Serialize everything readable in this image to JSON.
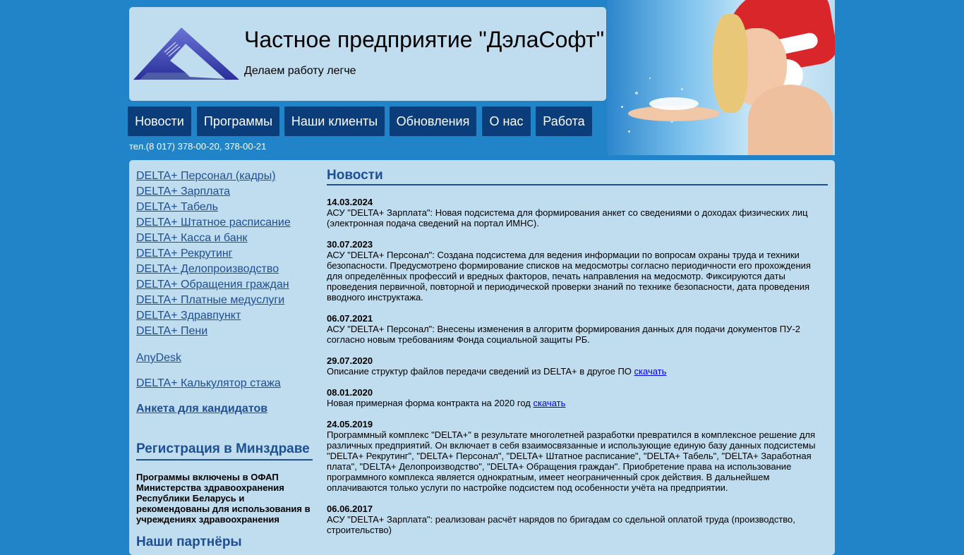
{
  "header": {
    "title": "Частное предприятие \"ДэлаСофт\"",
    "slogan": "Делаем работу легче"
  },
  "nav": [
    {
      "label": "Новости"
    },
    {
      "label": "Программы"
    },
    {
      "label": "Наши клиенты"
    },
    {
      "label": "Обновления"
    },
    {
      "label": "О нас"
    },
    {
      "label": "Работа"
    }
  ],
  "phone": "тел.(8 017) 378-00-20, 378-00-21",
  "sidebar": {
    "programs": [
      "DELTA+ Персонал (кадры)",
      "DELTA+ Зарплата",
      "DELTA+ Табель",
      "DELTA+ Штатное расписание",
      "DELTA+ Касса и банк",
      "DELTA+ Рекрутинг",
      "DELTA+ Делопроизводство",
      "DELTA+ Обращения граждан",
      "DELTA+ Платные медуслуги",
      "DELTA+ Здравпункт",
      "DELTA+ Пени"
    ],
    "anydesk": "AnyDesk",
    "calculator": "DELTA+ Калькулятор стажа",
    "anketa": "Анкета для кандидатов",
    "minzdrav_heading": "Регистрация в Минздраве",
    "minzdrav_text": "Программы включены в ОФАП Министерства здравоохранения Республики Беларусь и рекомендованы для использования в учреждениях здравоохранения",
    "partners_heading": "Наши партнёры"
  },
  "news": {
    "heading": "Новости",
    "items": [
      {
        "date": "14.03.2024",
        "text": "АСУ \"DELTA+ Зарплата\": Новая подсистема для формирования анкет со сведениями о доходах физических лиц (электронная подача сведений на портал ИМНС)."
      },
      {
        "date": "30.07.2023",
        "text": "АСУ \"DELTA+ Персонал\": Создана подсистема для ведения информации по вопросам охраны труда и техники безопасности. Предусмотрено формирование списков на медосмотры согласно периодичности его прохождения для определённых профессий и вредных факторов, печать направления на медосмотр. Фиксируются даты проведения первичной, повторной и периодической проверки знаний по технике безопасности, дата проведения вводного инструктажа."
      },
      {
        "date": "06.07.2021",
        "text": "АСУ \"DELTA+ Персонал\": Внесены изменения в алгоритм формирования данных для подачи документов ПУ-2 согласно новым требованиям Фонда социальной защиты РБ."
      },
      {
        "date": "29.07.2020",
        "text": "Описание структур файлов передачи сведений из DELTA+ в другое ПО",
        "link": "скачать"
      },
      {
        "date": "08.01.2020",
        "text": "Новая примерная форма контракта на 2020 год",
        "link": "скачать"
      },
      {
        "date": "24.05.2019",
        "text": "Программный комплекс \"DELTA+\" в результате многолетней разработки превратился в комплексное решение для различных предприятий. Он включает в себя взаимосвязанные и использующие единую базу данных подсистемы \"DELTA+ Рекрутинг\", \"DELTA+ Персонал\", \"DELTA+ Штатное расписание\", \"DELTA+ Табель\", \"DELTA+ Заработная плата\", \"DELTA+ Делопроизводство\", \"DELTA+ Обращения граждан\". Приобретение права на использование программного комплекса является однократным, имеет неограниченный срок действия. В дальнейшем оплачиваются только услуги по настройке подсистем под особенности учёта на предприятии."
      },
      {
        "date": "06.06.2017",
        "text": "АСУ \"DELTA+ Зарплата\": реализован расчёт нарядов по бригадам со сдельной оплатой труда (производство, строительство)"
      }
    ]
  }
}
